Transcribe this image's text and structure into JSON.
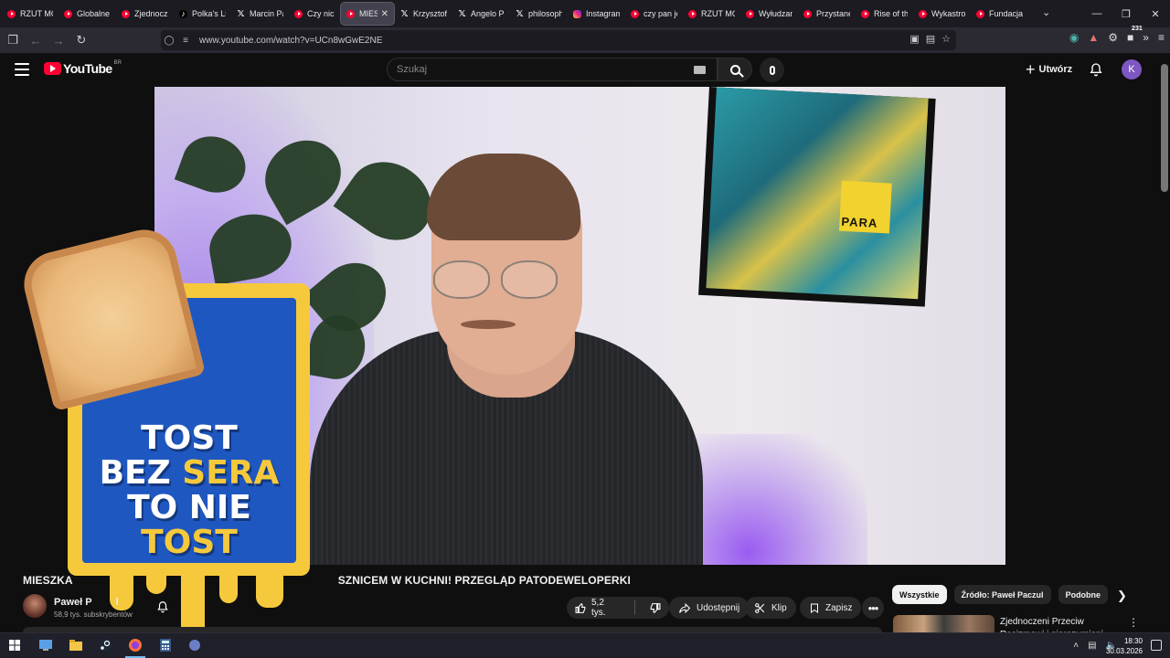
{
  "browser": {
    "tabs": [
      {
        "label": "RZUT MO",
        "icon": "youtube-icon",
        "active": false
      },
      {
        "label": "Globalne",
        "icon": "youtube-icon",
        "active": false
      },
      {
        "label": "Zjednocz",
        "icon": "youtube-icon",
        "active": false
      },
      {
        "label": "Polka's Lif",
        "icon": "tiktok-icon",
        "active": false
      },
      {
        "label": "Marcin Pa",
        "icon": "x-icon",
        "active": false
      },
      {
        "label": "Czy nic ni",
        "icon": "youtube-icon",
        "active": false
      },
      {
        "label": "MIESZ",
        "icon": "youtube-icon",
        "active": true
      },
      {
        "label": "Krzysztof",
        "icon": "x-icon",
        "active": false
      },
      {
        "label": "Angelo P",
        "icon": "x-icon",
        "active": false
      },
      {
        "label": "philosoph",
        "icon": "x-icon",
        "active": false
      },
      {
        "label": "Instagram",
        "icon": "instagram-icon",
        "active": false
      },
      {
        "label": "czy pan je",
        "icon": "youtube-icon",
        "active": false
      },
      {
        "label": "RZUT MO",
        "icon": "youtube-icon",
        "active": false
      },
      {
        "label": "Wyłudzan",
        "icon": "youtube-icon",
        "active": false
      },
      {
        "label": "Przystane",
        "icon": "youtube-icon",
        "active": false
      },
      {
        "label": "Rise of th",
        "icon": "youtube-icon",
        "active": false
      },
      {
        "label": "Wykastro",
        "icon": "youtube-icon",
        "active": false
      },
      {
        "label": "Fundacja",
        "icon": "youtube-icon",
        "active": false
      }
    ],
    "url": "www.youtube.com/watch?v=UCn8wGwE2NE",
    "extension_badge": "231"
  },
  "youtube": {
    "logo_text": "YouTube",
    "country_code": "BR",
    "search_placeholder": "Szukaj",
    "create_label": "Utwórz",
    "avatar_letter": "K",
    "accent": "#ff0033"
  },
  "thumbnail": {
    "line1": "TOST",
    "line2_a": "BEZ ",
    "line2_b": "SERA",
    "line3": "TO NIE",
    "line4": "TOST"
  },
  "video": {
    "title_start": "MIESZKA",
    "title_end": "SZNICEM W KUCHNI! PRZEGLĄD PATODEWELOPERKI",
    "channel_name": "Paweł P",
    "channel_name_end": "l",
    "subscribers": "58,9 tys. subskrybentów",
    "likes": "5,2 tys.",
    "share_label": "Udostępnij",
    "clip_label": "Klip",
    "save_label": "Zapisz"
  },
  "sidebar": {
    "chips": [
      "Wszystkie",
      "Źródło: Paweł Paczul",
      "Podobne"
    ],
    "recommended": [
      {
        "title": "Zjednoczeni Przeciw Rasizmowi i nierozumieni"
      }
    ]
  },
  "taskbar": {
    "time": "18:30",
    "date": "30.03.2026"
  }
}
